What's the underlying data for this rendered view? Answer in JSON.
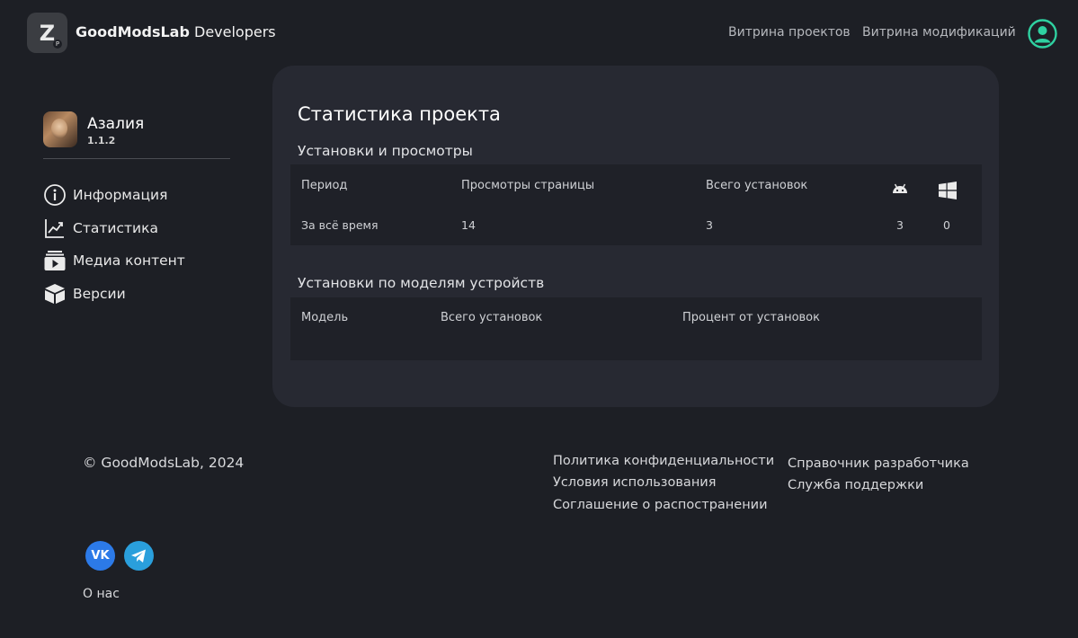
{
  "header": {
    "logo_glyph": "Z",
    "logo_badge": "P",
    "brand_strong": "GoodModsLab",
    "brand_rest": "Developers",
    "nav": [
      {
        "label": "Витрина проектов"
      },
      {
        "label": "Витрина модификаций"
      }
    ],
    "profile_icon": "user-circle-icon",
    "accent_color": "#2fd1a1"
  },
  "sidebar": {
    "project_name": "Азалия",
    "project_version": "1.1.2",
    "items": [
      {
        "label": "Информация",
        "icon": "info-icon"
      },
      {
        "label": "Статистика",
        "icon": "chart-line-icon"
      },
      {
        "label": "Медиа контент",
        "icon": "media-play-icon"
      },
      {
        "label": "Версии",
        "icon": "box-icon"
      }
    ]
  },
  "main": {
    "title": "Статистика проекта",
    "installs_section": {
      "title": "Установки и просмотры",
      "columns": [
        "Период",
        "Просмотры страницы",
        "Всего установок"
      ],
      "platform_icons": [
        "android-icon",
        "windows-icon"
      ],
      "rows": [
        {
          "period": "За всё время",
          "views": "14",
          "installs": "3",
          "android": "3",
          "windows": "0"
        }
      ]
    },
    "devices_section": {
      "title": "Установки по моделям устройств",
      "columns": [
        "Модель",
        "Всего установок",
        "Процент от установок"
      ]
    }
  },
  "footer": {
    "copyright": "© GoodModsLab, 2024",
    "links_col1": [
      "Политика конфиденциальности",
      "Условия использования",
      "Соглашение о распостранении"
    ],
    "links_col2": [
      "Справочник разработчика",
      "Служба поддержки"
    ],
    "social": [
      {
        "icon": "vk-icon",
        "label": "VK"
      },
      {
        "icon": "telegram-icon"
      }
    ],
    "about": "О нас"
  }
}
